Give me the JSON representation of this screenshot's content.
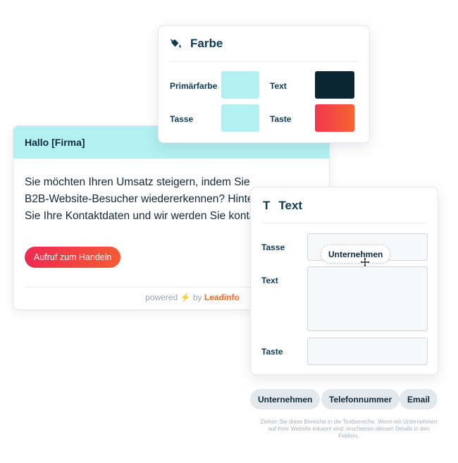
{
  "widget": {
    "greeting": "Hallo [Firma]",
    "body_lines": [
      "Sie möchten Ihren Umsatz steigern, indem Sie",
      "B2B-Website-Besucher wiedererkennen? Hinter",
      "Sie Ihre Kontaktdaten und wir werden Sie konta"
    ],
    "cta_label": "Aufruf zum Handeln",
    "powered_prefix": "powered",
    "powered_bolt": "⚡",
    "powered_by": "by",
    "powered_brand": "Leadinfo"
  },
  "color_panel": {
    "title": "Farbe",
    "icon": "paint-bucket-icon",
    "primary_label": "Primärfarbe",
    "text_label": "Text",
    "cup_label": "Tasse",
    "button_label": "Taste",
    "colors": {
      "primary": "#b3f0f2",
      "text": "#0c2535",
      "cup": "#b3f0f2",
      "button_gradient": [
        "#f23650",
        "#f56530"
      ]
    }
  },
  "text_panel": {
    "title": "Text",
    "title_icon": "T",
    "cup_label": "Tasse",
    "text_label": "Text",
    "button_label": "Taste"
  },
  "drag_chip": "Unternehmen",
  "chips": [
    "Unternehmen",
    "Telefonnummer",
    "Email"
  ],
  "hint": "Ziehen Sie diese Bereiche in die Textbereiche. Wenn ein Unternehmen auf Ihrer Website erkannt wird, erscheinen dessen Details in den Feldern."
}
